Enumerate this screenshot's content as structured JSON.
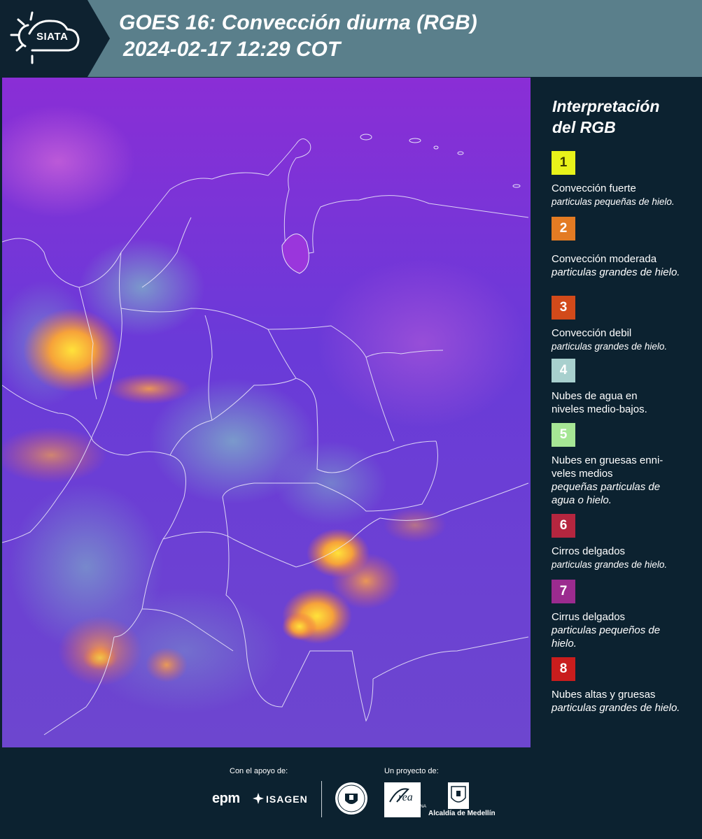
{
  "header": {
    "logo_text": "SIATA",
    "title_line1": "GOES 16: Convección diurna (RGB)",
    "title_line2": "2024-02-17 12:29 COT"
  },
  "legend": {
    "title_line1": "Interpretación",
    "title_line2": "del RGB",
    "items": [
      {
        "number": "1",
        "color": "#e8f21a",
        "text_color": "#3a3a00",
        "label": "Convección fuerte",
        "desc": "particulas pequeñas de hielo."
      },
      {
        "number": "2",
        "color": "#e37b23",
        "text_color": "#ffffff",
        "label": "Convección moderada",
        "desc": "particulas grandes de hielo."
      },
      {
        "number": "3",
        "color": "#d24a1a",
        "text_color": "#ffffff",
        "label": "Convección debil",
        "desc": "particulas grandes de hielo."
      },
      {
        "number": "4",
        "color": "#a8d0ce",
        "text_color": "#ffffff",
        "label": "Nubes de agua en niveles medio-bajos.",
        "desc": ""
      },
      {
        "number": "5",
        "color": "#a6e695",
        "text_color": "#ffffff",
        "label": "Nubes en gruesas enni-veles medios",
        "desc": "pequeñas particulas de agua o hielo."
      },
      {
        "number": "6",
        "color": "#b5263f",
        "text_color": "#ffffff",
        "label": "Cirros delgados",
        "desc": "particulas grandes de hielo."
      },
      {
        "number": "7",
        "color": "#9b2b8f",
        "text_color": "#ffffff",
        "label": "Cirrus delgados",
        "desc": "particulas pequeños de hielo."
      },
      {
        "number": "8",
        "color": "#c91d1d",
        "text_color": "#ffffff",
        "label": "Nubes altas y gruesas",
        "desc": "particulas grandes de hielo."
      }
    ]
  },
  "footer": {
    "support_label": "Con el apoyo de:",
    "project_label": "Un proyecto de:",
    "logos": {
      "epm": "epm",
      "isagen": "ISAGEN",
      "amva_line1": "METROPOLITANA",
      "amva_line2": "Valle de Aburrá",
      "alcaldia": "Alcaldía de Medellín"
    }
  },
  "colors": {
    "header_bg": "#5a7f8b",
    "panel_bg": "#0c2230",
    "map_base": "#6a2fd0"
  }
}
